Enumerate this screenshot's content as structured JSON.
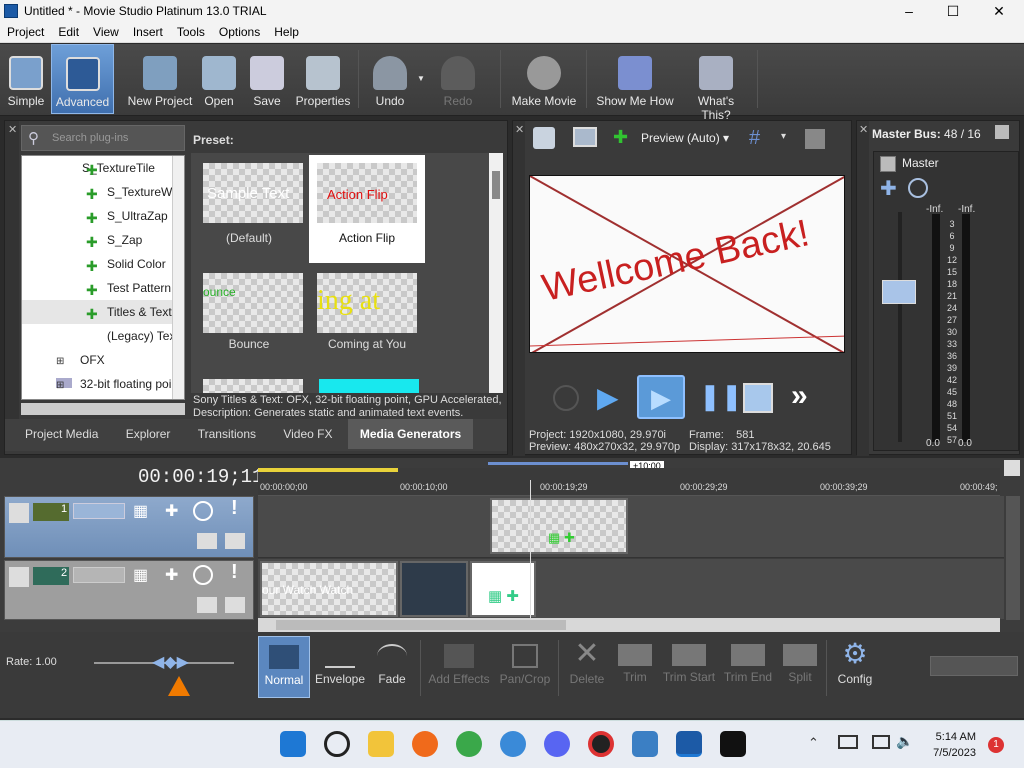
{
  "window": {
    "title": "Untitled * - Movie Studio Platinum 13.0 TRIAL"
  },
  "menu": [
    "Project",
    "Edit",
    "View",
    "Insert",
    "Tools",
    "Options",
    "Help"
  ],
  "toolbar": {
    "simple": "Simple",
    "advanced": "Advanced",
    "new_project": "New Project",
    "open": "Open",
    "save": "Save",
    "properties": "Properties",
    "undo": "Undo",
    "redo": "Redo",
    "make_movie": "Make Movie",
    "show_me_how": "Show Me How",
    "whats_this": "What's This?"
  },
  "plugins": {
    "search_placeholder": "Search plug-ins",
    "items": [
      "S_TextureTile",
      "S_TextureWe",
      "S_UltraZap",
      "S_Zap",
      "Solid Color",
      "Test Pattern",
      "Titles & Text",
      "(Legacy) Tex"
    ],
    "folders": [
      "OFX",
      "32-bit floating poin"
    ]
  },
  "preset": {
    "header": "Preset:",
    "items": [
      {
        "thumb": "Sample Text",
        "label": "(Default)"
      },
      {
        "thumb": "Action Flip",
        "label": "Action Flip"
      },
      {
        "thumb": "ounce",
        "label": "Bounce"
      },
      {
        "thumb": "ing at",
        "label": "Coming at You"
      }
    ],
    "description_line1": "Sony Titles & Text: OFX, 32-bit floating point, GPU Accelerated,",
    "description_line2": "Description: Generates static and animated text events."
  },
  "bottom_tabs": [
    "Project Media",
    "Explorer",
    "Transitions",
    "Video FX",
    "Media Generators"
  ],
  "preview": {
    "mode": "Preview (Auto)",
    "text": "Wellcome Back!",
    "project_label": "Project:",
    "project_value": "1920x1080, 29.970i",
    "preview_label": "Preview:",
    "preview_value": "480x270x32, 29.970p",
    "frame_label": "Frame:",
    "frame_value": "581",
    "display_label": "Display:",
    "display_value": "317x178x32, 20.645"
  },
  "master": {
    "title": "Master Bus:",
    "count": "48 / 16",
    "label": "Master",
    "inf_left": "-Inf.",
    "inf_right": "-Inf.",
    "scale": [
      "3",
      "6",
      "9",
      "12",
      "15",
      "18",
      "21",
      "24",
      "27",
      "30",
      "33",
      "36",
      "39",
      "42",
      "45",
      "48",
      "51",
      "54",
      "57"
    ],
    "bottom_left": "0.0",
    "bottom_right": "0.0"
  },
  "timeline": {
    "timecode": "00:00:19;11",
    "offset_badge": "+10:00",
    "ruler": [
      "00:00:00;00",
      "00:00:10;00",
      "00:00:19;29",
      "00:00:29;29",
      "00:00:39;29",
      "00:00:49;"
    ],
    "track1_num": "1",
    "track2_num": "2",
    "clip_text": "our Watch Watch"
  },
  "edit_tools": {
    "rate": "Rate: 1.00",
    "normal": "Normal",
    "envelope": "Envelope",
    "fade": "Fade",
    "add_effects": "Add Effects",
    "pan_crop": "Pan/Crop",
    "delete": "Delete",
    "trim": "Trim",
    "trim_start": "Trim Start",
    "trim_end": "Trim End",
    "split": "Split",
    "config": "Config"
  },
  "taskbar": {
    "time": "5:14 AM",
    "date": "7/5/2023",
    "notif": "1"
  },
  "colors": {
    "accent": "#3f6fae",
    "tab_selected": "#5a5a5a",
    "play_blue": "#5fa8f0"
  }
}
